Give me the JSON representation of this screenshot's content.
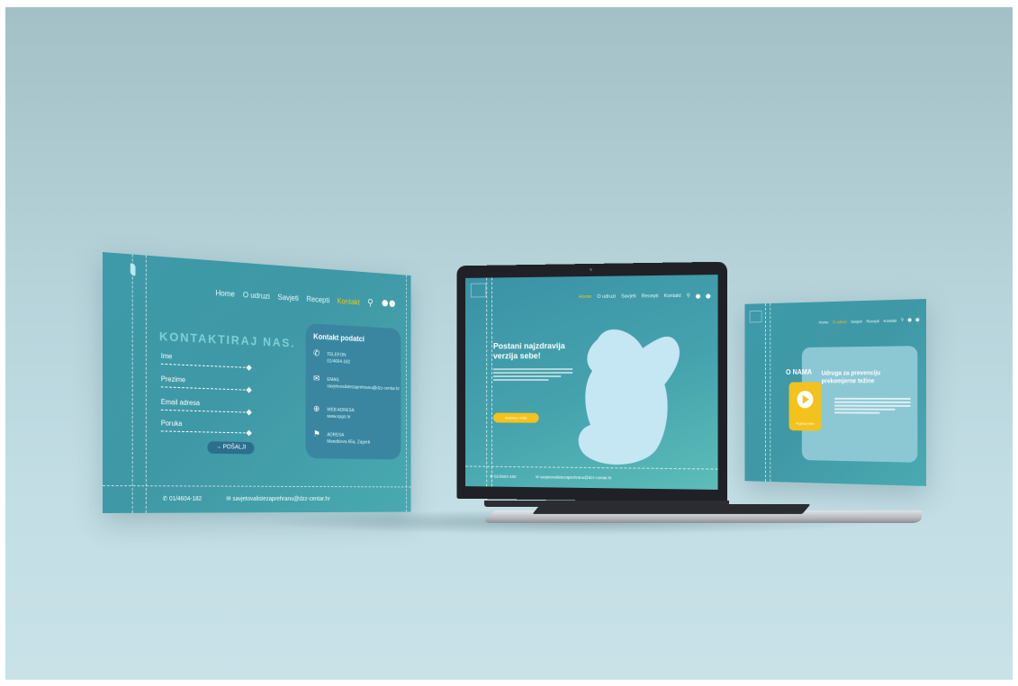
{
  "contact_page": {
    "nav": [
      "Home",
      "O udruzi",
      "Savjeti",
      "Recepti",
      "Kontakt"
    ],
    "nav_active": "Kontakt",
    "title": "KONTAKTIRAJ NAS.",
    "form_fields": [
      "Ime",
      "Prezime",
      "Email adresa",
      "Poruka"
    ],
    "send_button": "→ POŠALJI",
    "card_title": "Kontakt podatci",
    "contact_items": [
      {
        "label": "TELEFON",
        "value": "01/4604-182"
      },
      {
        "label": "EMAIL",
        "value": "savjetovalistezaprehranu@dzz-centar.hr"
      },
      {
        "label": "WEB ADRESA",
        "value": "www.spgo.hr"
      },
      {
        "label": "ADRESA",
        "value": "Mandićeva 65a, Zagreb"
      }
    ],
    "footer_phone": "01/4604-182",
    "footer_email": "savjetovalistezaprehranu@dzz-centar.hr"
  },
  "home_page": {
    "nav": [
      "Home",
      "O udruzi",
      "Savjeti",
      "Recepti",
      "Kontakt"
    ],
    "nav_active": "Home",
    "hero_title": "Postani najzdravija verzija sebe!",
    "cta": "SAZNAJ VIŠE",
    "footer_phone": "01/4604-182",
    "footer_email": "savjetovalistezaprehranu@dzz-centar.hr"
  },
  "about_page": {
    "nav": [
      "Home",
      "O udruzi",
      "Savjeti",
      "Recepti",
      "Kontakt"
    ],
    "nav_active": "O udruzi",
    "section_title": "O NAMA",
    "heading": "Udruga za prevenciju prekomjerne težine",
    "video_label": "Pogledaj video"
  },
  "colors": {
    "accent": "#f3c21c",
    "panel": "#3e9aa8",
    "background": "#b6d3da"
  }
}
